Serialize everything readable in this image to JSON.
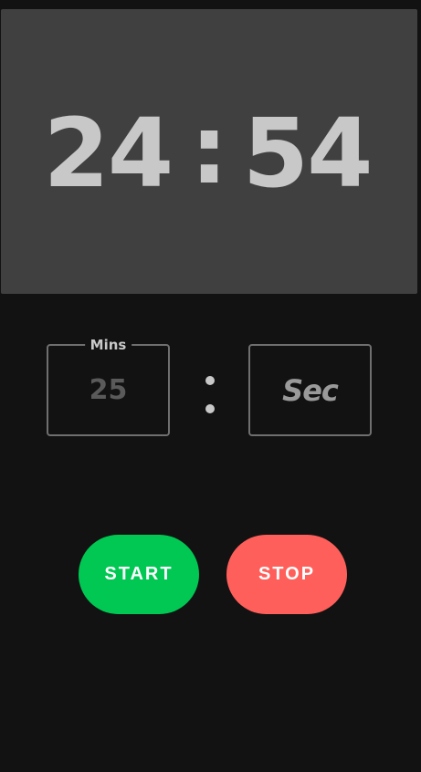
{
  "timer": {
    "minutes": "24",
    "separator": ":",
    "seconds": "54"
  },
  "inputs": {
    "minutes": {
      "legend": "Mins",
      "value": "25"
    },
    "seconds": {
      "placeholder": "Sec"
    }
  },
  "buttons": {
    "start_label": "START",
    "stop_label": "STOP"
  },
  "colors": {
    "background": "#121212",
    "display_panel": "#404040",
    "start": "#00c853",
    "stop": "#ff5f5a",
    "text": "#c8c8c8"
  }
}
